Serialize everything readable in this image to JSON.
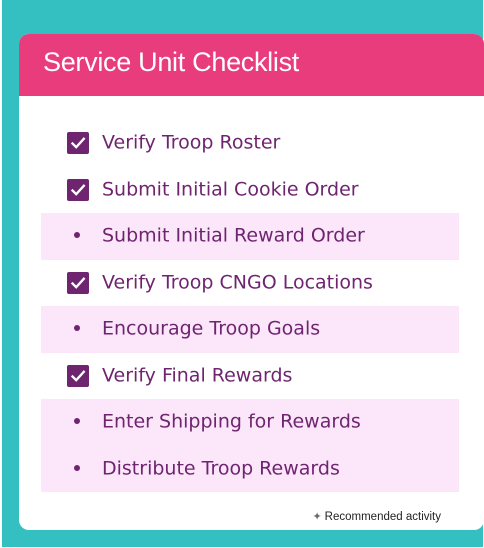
{
  "card": {
    "title": "Service Unit Checklist"
  },
  "checklist": {
    "items": [
      {
        "label": "Verify Troop Roster",
        "checked": true,
        "recommended": false
      },
      {
        "label": "Submit Initial Cookie Order",
        "checked": true,
        "recommended": false
      },
      {
        "label": "Submit Initial Reward Order",
        "checked": false,
        "recommended": true
      },
      {
        "label": "Verify Troop CNGO Locations",
        "checked": true,
        "recommended": false
      },
      {
        "label": "Encourage Troop Goals",
        "checked": false,
        "recommended": true
      },
      {
        "label": "Verify Final Rewards",
        "checked": true,
        "recommended": false
      },
      {
        "label": "Enter Shipping for Rewards",
        "checked": false,
        "recommended": true
      },
      {
        "label": "Distribute Troop Rewards",
        "checked": false,
        "recommended": true
      }
    ]
  },
  "footnote": {
    "symbol": "✦",
    "text": "Recommended activity"
  },
  "colors": {
    "frame": "#34bfc1",
    "header": "#e83c7c",
    "accent": "#6f2470",
    "highlight": "#fbe6fa"
  }
}
